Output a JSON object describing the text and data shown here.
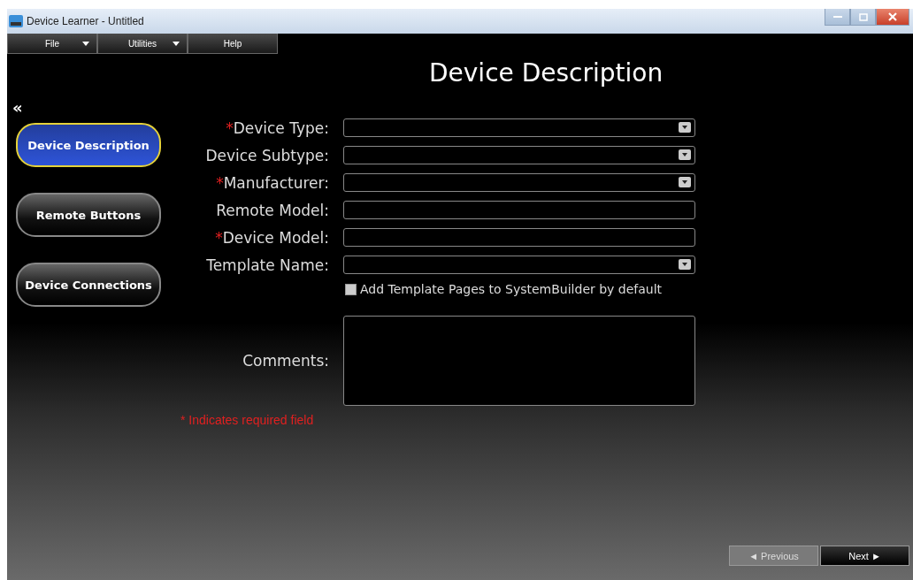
{
  "window": {
    "title": "Device Learner - Untitled"
  },
  "menu": [
    {
      "label": "File",
      "dropdown": true
    },
    {
      "label": "Utilities",
      "dropdown": true
    },
    {
      "label": "Help",
      "dropdown": false
    }
  ],
  "heading": "Device Description",
  "collapse": "«",
  "nav": [
    {
      "label": "Device Description",
      "selected": true
    },
    {
      "label": "Remote Buttons",
      "selected": false
    },
    {
      "label": "Device Connections",
      "selected": false
    }
  ],
  "fields": [
    {
      "kind": "select",
      "required_mark": "*",
      "label": "Device Type:"
    },
    {
      "kind": "select",
      "label": "Device Subtype:"
    },
    {
      "kind": "select",
      "required_mark": "*",
      "label": "Manufacturer:"
    },
    {
      "kind": "text",
      "label": "Remote Model:"
    },
    {
      "kind": "text",
      "required_mark": "*",
      "label": "Device Model:"
    },
    {
      "kind": "select",
      "label": "Template Name:"
    }
  ],
  "template_option": {
    "label": "Add Template Pages to SystemBuilder by default",
    "checked": false
  },
  "comments": {
    "label": "Comments:"
  },
  "required_note": "* Indicates required field",
  "footer": {
    "previous": "◄ Previous",
    "next": "Next ►"
  }
}
